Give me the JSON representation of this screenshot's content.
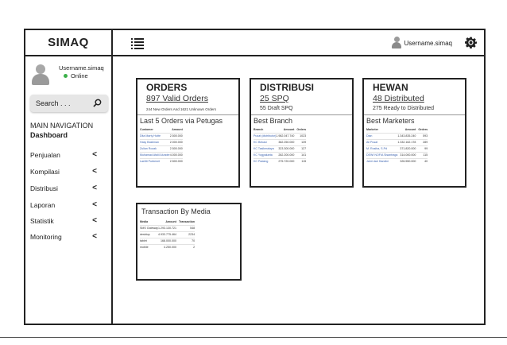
{
  "app": {
    "brand": "SIMAQ"
  },
  "topbar": {
    "username": "Username.simaq"
  },
  "sidebar": {
    "username": "Username.simaq",
    "status": "Online",
    "search_placeholder": "Search . . .",
    "nav_header": "MAIN NAVIGATION",
    "active_item": "Dashboard",
    "items": [
      {
        "label": "Penjualan"
      },
      {
        "label": "Kompilasi"
      },
      {
        "label": "Distribusi"
      },
      {
        "label": "Laporan"
      },
      {
        "label": "Statistik"
      },
      {
        "label": "Monitoring"
      }
    ],
    "chevron": "<"
  },
  "cards": {
    "orders": {
      "title": "ORDERS",
      "big": "897 Valid Orders",
      "sub": "244 New Orders And 1621 Unknown Orders",
      "list_title": "Last 5 Orders via Petugas",
      "headers": [
        "Customer",
        "Amount"
      ],
      "rows": [
        [
          "Dita Marty Hutte",
          "2.500.000"
        ],
        [
          "Hasy Basliman",
          "2.000.000"
        ],
        [
          "Zulian Rozak",
          "2.500.000"
        ],
        [
          "Muhamad Afalil Alunder",
          "4.000.000"
        ],
        [
          "Laelitt Purbenet",
          "2.500.000"
        ]
      ]
    },
    "distribusi": {
      "title": "DISTRIBUSI",
      "big": "25 SPQ",
      "sub": "55 Draft SPQ",
      "list_title": "Best Branch",
      "headers": [
        "Branch",
        "Amount",
        "Orders"
      ],
      "rows": [
        [
          "Pusat (distributor)",
          "1.982.047.740",
          "1023"
        ],
        [
          "KC Bekasi",
          "382.250.000",
          "139"
        ],
        [
          "KC Tasikmalaya",
          "323.300.000",
          "127"
        ],
        [
          "KC Yogyakarta",
          "282.200.000",
          "141"
        ],
        [
          "KC Padang",
          "275.720.000",
          "115"
        ]
      ]
    },
    "hewan": {
      "title": "HEWAN",
      "big": "48 Distributed",
      "sub": "275 Ready to Distributed",
      "list_title": "Best Marketers",
      "headers": [
        "Marketer",
        "Amount",
        "Orders"
      ],
      "rows": [
        [
          "Dian",
          "1.343.835.240",
          "593"
        ],
        [
          "Ali Pusat",
          "1.332.162.178",
          "289"
        ],
        [
          "M. Rosiha, S.Pd",
          "371.820.000",
          "99"
        ],
        [
          "DEWI NOFIA Sisantraga",
          "314.000.000",
          "115"
        ],
        [
          "Jahri dari Handini",
          "326.550.000",
          "40"
        ]
      ]
    }
  },
  "media": {
    "title": "Transaction By Media",
    "headers": [
      "Media",
      "Amount",
      "Transaction"
    ],
    "rows": [
      [
        "SMS Gateway",
        "1.293.130.721",
        "548"
      ],
      [
        "desktop",
        "4.933.775.464",
        "2234"
      ],
      [
        "tablet",
        "168.000.000",
        "70"
      ],
      [
        "mobile",
        "4.250.000",
        "2"
      ]
    ]
  }
}
